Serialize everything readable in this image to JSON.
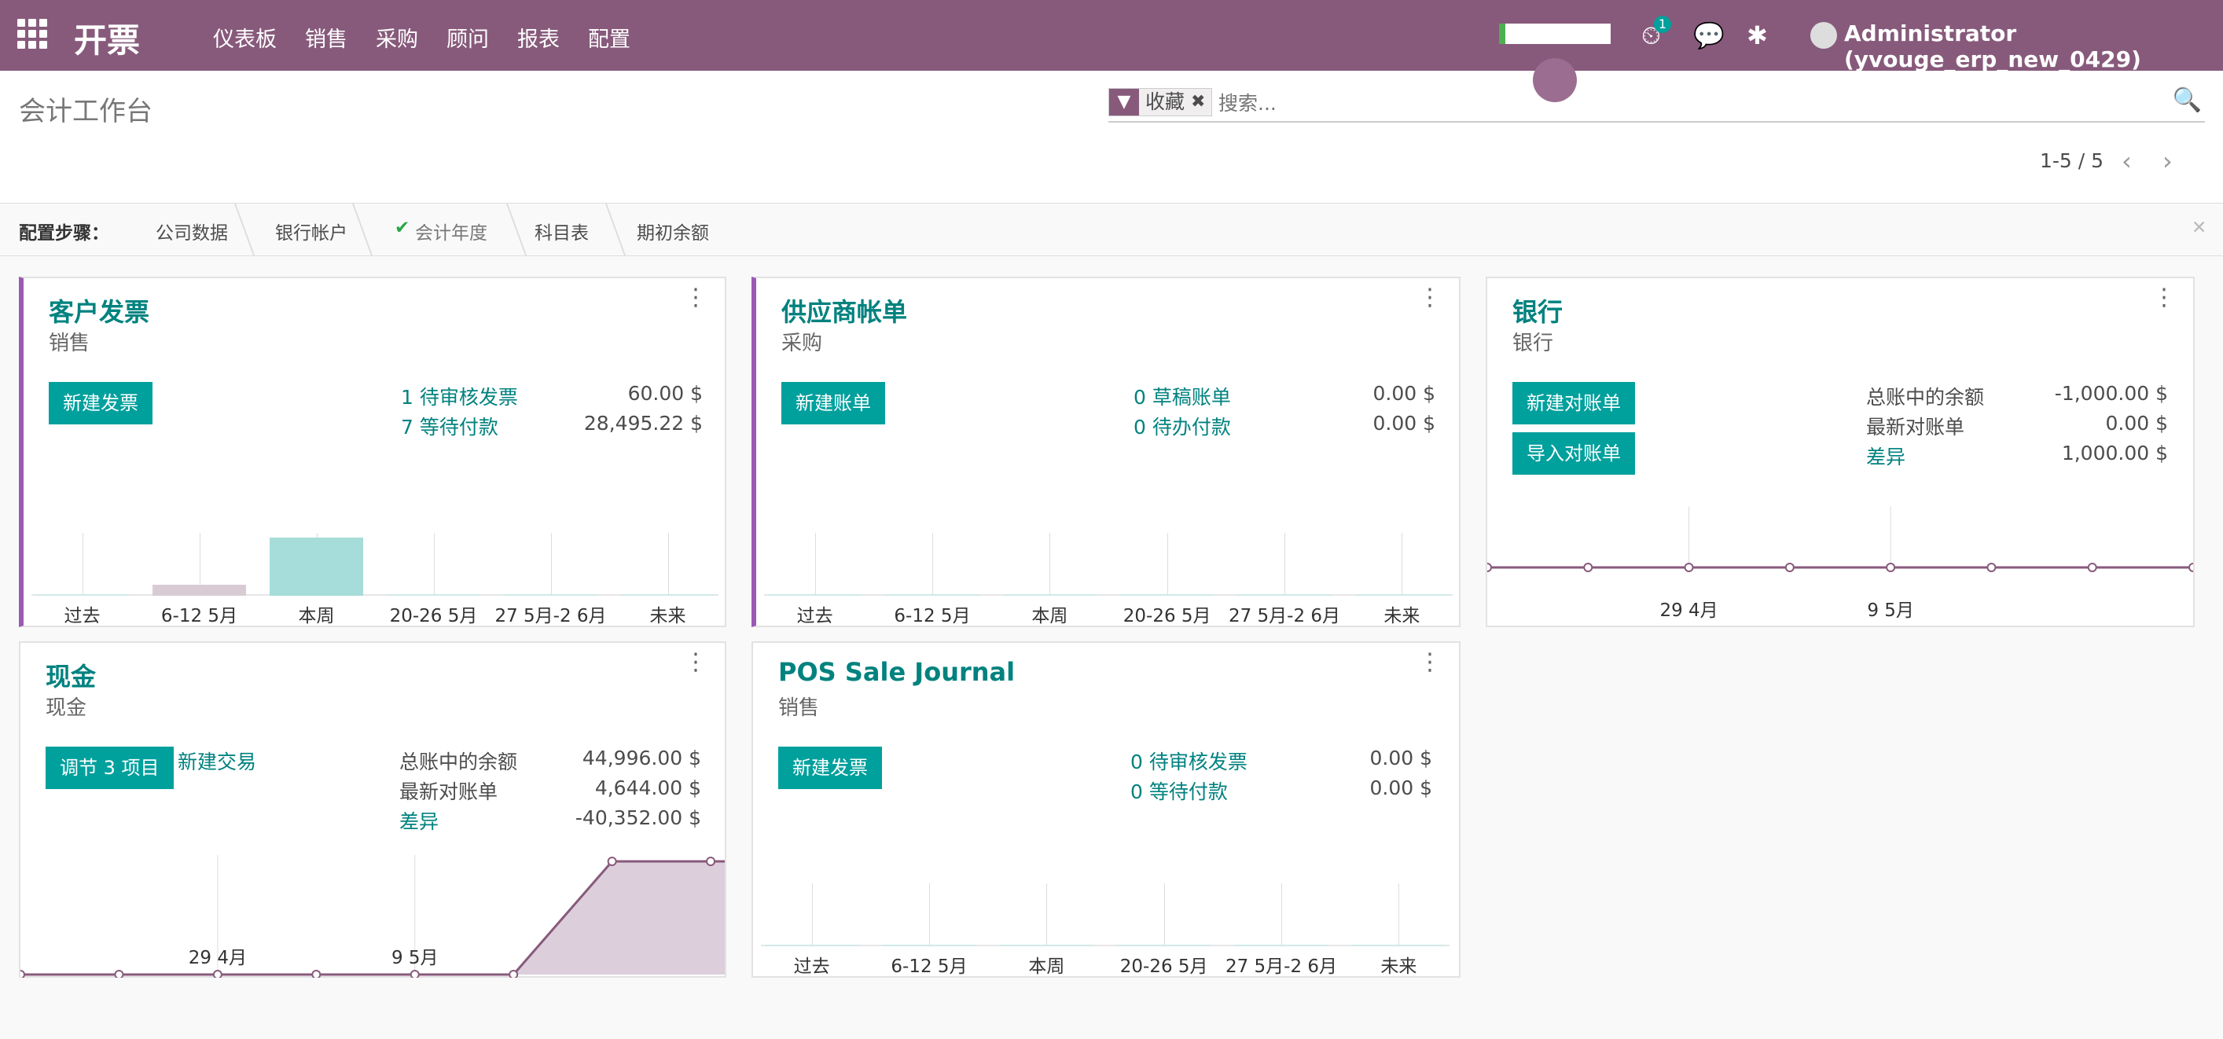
{
  "navbar": {
    "brand": "开票",
    "menu": [
      "仪表板",
      "销售",
      "采购",
      "顾问",
      "报表",
      "配置"
    ],
    "activity_count": "1",
    "user": "Administrator (yvouge_erp_new_0429)"
  },
  "control": {
    "title": "会计工作台",
    "facet": "收藏",
    "search_placeholder": "搜索...",
    "pager": "1-5 / 5"
  },
  "steps": {
    "label": "配置步骤：",
    "items": [
      "公司数据",
      "银行帐户",
      "会计年度",
      "科目表",
      "期初余额"
    ],
    "done_mark": "✔"
  },
  "cards": {
    "customer": {
      "title": "客户发票",
      "subtitle": "销售",
      "button": "新建发票",
      "rows": [
        {
          "label": "1 待审核发票",
          "value": "60.00 $"
        },
        {
          "label": "7 等待付款",
          "value": "28,495.22 $"
        }
      ],
      "chart_ticks": [
        "过去",
        "6-12 5月",
        "本周",
        "20-26 5月",
        "27 5月-2 6月",
        "未来"
      ]
    },
    "vendor": {
      "title": "供应商帐单",
      "subtitle": "采购",
      "button": "新建账单",
      "rows": [
        {
          "label": "0 草稿账单",
          "value": "0.00 $"
        },
        {
          "label": "0 待办付款",
          "value": "0.00 $"
        }
      ],
      "chart_ticks": [
        "过去",
        "6-12 5月",
        "本周",
        "20-26 5月",
        "27 5月-2 6月",
        "未来"
      ]
    },
    "bank": {
      "title": "银行",
      "subtitle": "银行",
      "button1": "新建对账单",
      "button2": "导入对账单",
      "rows": [
        {
          "label": "总账中的余额",
          "value": "-1,000.00 $"
        },
        {
          "label": "最新对账单",
          "value": "0.00 $"
        },
        {
          "label": "差异",
          "value": "1,000.00 $"
        }
      ],
      "chart_ticks": [
        "29 4月",
        "9 5月"
      ]
    },
    "cash": {
      "title": "现金",
      "subtitle": "现金",
      "button": "调节 3 项目",
      "link": "新建交易",
      "rows": [
        {
          "label": "总账中的余额",
          "value": "44,996.00 $"
        },
        {
          "label": "最新对账单",
          "value": "4,644.00 $"
        },
        {
          "label": "差异",
          "value": "-40,352.00 $"
        }
      ],
      "chart_ticks": [
        "29 4月",
        "9 5月"
      ]
    },
    "pos": {
      "title": "POS Sale Journal",
      "subtitle": "销售",
      "button": "新建发票",
      "rows": [
        {
          "label": "0 待审核发票",
          "value": "0.00 $"
        },
        {
          "label": "0 等待付款",
          "value": "0.00 $"
        }
      ],
      "chart_ticks": [
        "过去",
        "6-12 5月",
        "本周",
        "20-26 5月",
        "27 5月-2 6月",
        "未来"
      ]
    }
  },
  "chart_data": [
    {
      "type": "bar",
      "categories": [
        "过去",
        "6-12 5月",
        "本周",
        "20-26 5月",
        "27 5月-2 6月",
        "未来"
      ],
      "values": [
        0,
        60,
        28435.22,
        0,
        0,
        0
      ]
    },
    {
      "type": "bar",
      "categories": [
        "过去",
        "6-12 5月",
        "本周",
        "20-26 5月",
        "27 5月-2 6月",
        "未来"
      ],
      "values": [
        0,
        0,
        0,
        0,
        0,
        0
      ]
    },
    {
      "type": "line",
      "x_ticks": [
        "29 4月",
        "9 5月"
      ],
      "values": [
        0,
        0,
        0,
        0,
        0,
        0,
        0,
        0
      ]
    },
    {
      "type": "area",
      "x_ticks": [
        "29 4月",
        "9 5月"
      ],
      "values": [
        0,
        0,
        0,
        0,
        0,
        0,
        44996,
        44996
      ]
    },
    {
      "type": "bar",
      "categories": [
        "过去",
        "6-12 5月",
        "本周",
        "20-26 5月",
        "27 5月-2 6月",
        "未来"
      ],
      "values": [
        0,
        0,
        0,
        0,
        0,
        0
      ]
    }
  ]
}
